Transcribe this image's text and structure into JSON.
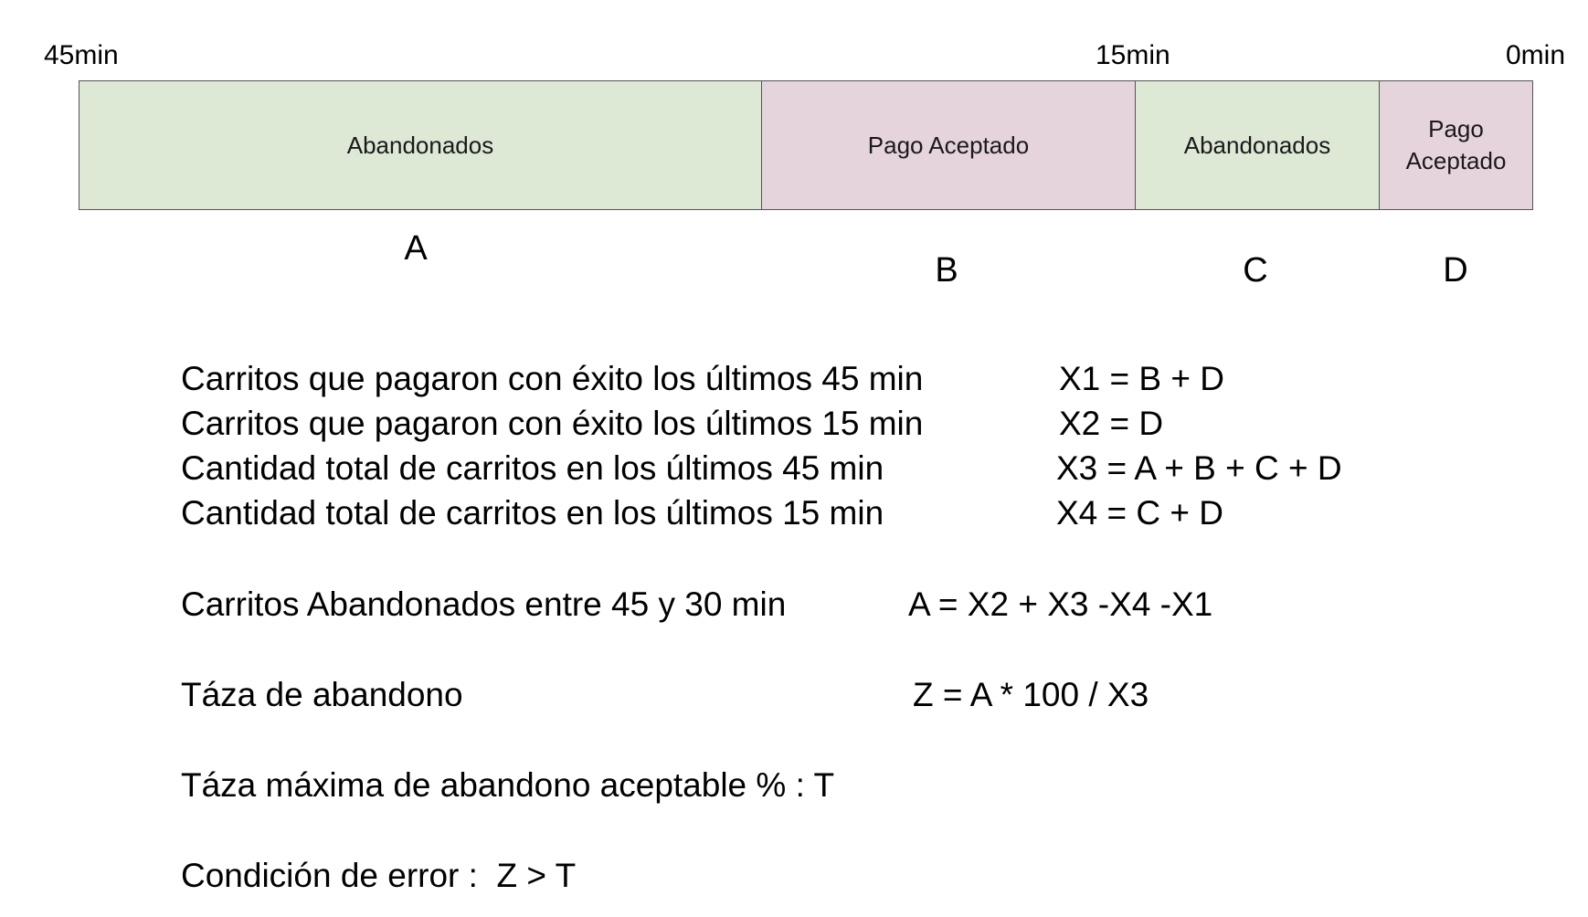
{
  "timeline": {
    "markers": {
      "start": "45min",
      "middle": "15min",
      "end": "0min"
    },
    "segments": [
      {
        "label": "Abandonados",
        "letter": "A",
        "color": "#dde9d5"
      },
      {
        "label": "Pago Aceptado",
        "letter": "B",
        "color": "#e6d4dd"
      },
      {
        "label": "Abandonados",
        "letter": "C",
        "color": "#dde9d5"
      },
      {
        "label": "Pago Aceptado",
        "letter": "D",
        "color": "#e6d4dd"
      }
    ]
  },
  "formulas": {
    "x1": {
      "description": "Carritos que pagaron con éxito los últimos 45 min",
      "expression": "X1 = B + D"
    },
    "x2": {
      "description": "Carritos que pagaron con éxito los últimos 15 min",
      "expression": "X2 = D"
    },
    "x3": {
      "description": "Cantidad total de carritos en los últimos 45 min",
      "expression": "X3 = A + B + C + D"
    },
    "x4": {
      "description": "Cantidad total de carritos en los últimos 15 min",
      "expression": "X4 = C + D"
    },
    "abandoned": {
      "description": "Carritos Abandonados entre 45 y 30 min",
      "expression": "A = X2 + X3 -X4 -X1"
    },
    "rate": {
      "description": "Táza de abandono",
      "expression": "Z = A * 100 / X3"
    }
  },
  "threshold": "Táza máxima de abandono aceptable % : T",
  "error_condition": "Condición de error :  Z > T"
}
